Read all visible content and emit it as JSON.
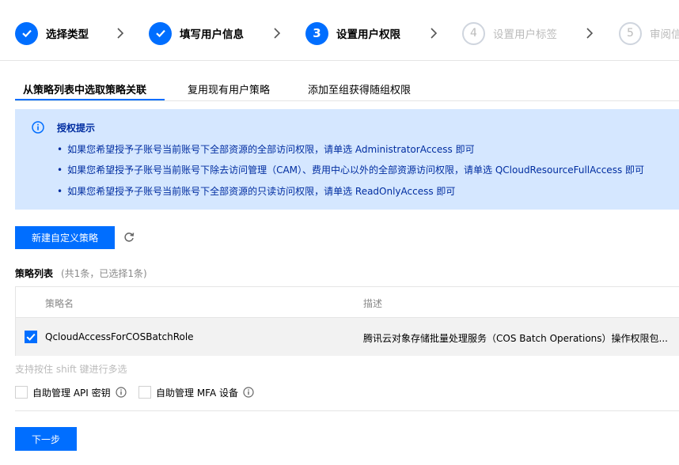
{
  "steps": [
    {
      "label": "选择类型",
      "status": "done"
    },
    {
      "label": "填写用户信息",
      "status": "done"
    },
    {
      "label": "设置用户权限",
      "status": "current",
      "number": "3"
    },
    {
      "label": "设置用户标签",
      "status": "todo",
      "number": "4"
    },
    {
      "label": "审阅信",
      "status": "todo",
      "number": "5"
    }
  ],
  "tabs": [
    "从策略列表中选取策略关联",
    "复用现有用户策略",
    "添加至组获得随组权限"
  ],
  "notice": {
    "title": "授权提示",
    "items": [
      "如果您希望授予子账号当前账号下全部资源的全部访问权限，请单选 AdministratorAccess 即可",
      "如果您希望授予子账号当前账号下除去访问管理（CAM）、费用中心以外的全部资源访问权限，请单选 QCloudResourceFullAccess 即可",
      "如果您希望授予子账号当前账号下全部资源的只读访问权限，请单选 ReadOnlyAccess 即可"
    ]
  },
  "new_policy_button": "新建自定义策略",
  "policy_list": {
    "title": "策略列表",
    "count": "(共1条，已选择1条)",
    "columns": [
      "策略名",
      "描述"
    ],
    "rows": [
      {
        "name": "QcloudAccessForCOSBatchRole",
        "description": "腾讯云对象存储批量处理服务（COS Batch Operations）操作权限包...",
        "checked": true
      }
    ]
  },
  "shift_hint": "支持按住 shift 键进行多选",
  "options": [
    "自助管理 API 密钥",
    "自助管理 MFA 设备"
  ],
  "next_button": "下一步",
  "colors": {
    "accent": "#006eff",
    "notice_bg": "#d5e7ff",
    "notice_text": "#002da0"
  }
}
